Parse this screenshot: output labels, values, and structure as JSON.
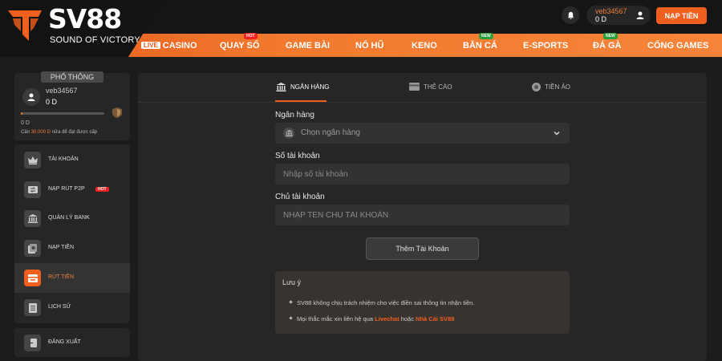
{
  "brand": {
    "name": "SV88",
    "tagline": "SOUND OF VICTORY"
  },
  "header": {
    "username": "veb34567",
    "balance": "0 D",
    "deposit_label": "NẠP TIỀN"
  },
  "nav": [
    {
      "live": "LIVE",
      "label": "CASINO"
    },
    {
      "label": "QUAY SỐ",
      "badge": "HOT"
    },
    {
      "label": "GAME BÀI"
    },
    {
      "label": "NỔ HŨ"
    },
    {
      "label": "KENO"
    },
    {
      "label": "BẮN CÁ",
      "badge": "NEW"
    },
    {
      "label": "E-SPORTS"
    },
    {
      "label": "ĐÁ GÀ",
      "badge": "NEW"
    },
    {
      "label": "CỔNG GAMES"
    }
  ],
  "profile": {
    "rank": "PHỔ THÔNG",
    "username": "veb34567",
    "balance": "0 D",
    "progress_value": "0 D",
    "progress_fraction": 0.02,
    "need_prefix": "Cần",
    "need_amount": "30,000 D",
    "need_suffix": "nữa để đạt được cấp"
  },
  "menu": [
    {
      "label": "TÀI KHOẢN",
      "icon": "crown-icon"
    },
    {
      "label": "NẠP RÚT P2P",
      "icon": "transfer-icon",
      "badge": "HOT"
    },
    {
      "label": "QUẢN LÝ BANK",
      "icon": "bank-icon"
    },
    {
      "label": "NẠP TIỀN",
      "icon": "deposit-icon"
    },
    {
      "label": "RÚT TIỀN",
      "icon": "withdraw-icon",
      "active": true
    },
    {
      "label": "LỊCH SỬ",
      "icon": "history-icon"
    }
  ],
  "logout_label": "ĐĂNG XUẤT",
  "tabs": [
    {
      "label": "NGÂN HÀNG",
      "icon": "bank-icon",
      "active": true
    },
    {
      "label": "THẺ CÀO",
      "icon": "card-icon"
    },
    {
      "label": "TIỀN ẢO",
      "icon": "coin-icon"
    }
  ],
  "form": {
    "bank_label": "Ngân hàng",
    "bank_placeholder": "Chọn ngân hàng",
    "account_no_label": "Số tài khoản",
    "account_no_placeholder": "Nhập số tài khoản",
    "holder_label": "Chủ tài khoản",
    "holder_placeholder": "NHẬP TÊN CHỦ TÀI KHOẢN",
    "submit_label": "Thêm Tài Khoản"
  },
  "note": {
    "title": "Lưu ý",
    "line1": "SV88 không chịu trách nhiệm cho việc điền sai thông tin nhận tiền.",
    "line2_prefix": "Mọi thắc mắc xin liên hệ qua",
    "line2_link1": "Livechat",
    "line2_mid": "hoặc",
    "line2_link2": "Nhà Cái SV88"
  },
  "colors": {
    "accent": "#f05f1e",
    "bg": "#1c1c1c",
    "panel": "#262626"
  }
}
